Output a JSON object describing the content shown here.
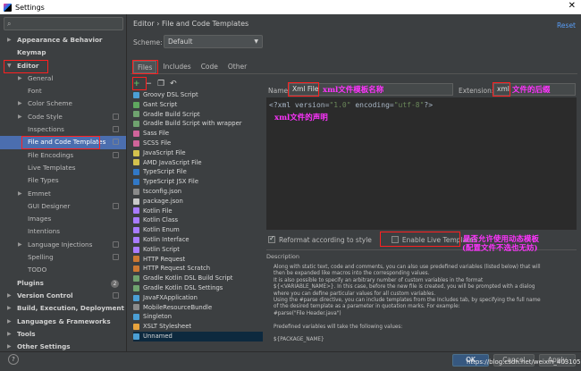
{
  "window": {
    "title": "Settings",
    "close": "✕"
  },
  "search": {
    "placeholder": "",
    "icon": "search-icon"
  },
  "sidebar": {
    "items": [
      {
        "label": "Appearance & Behavior",
        "level": 0,
        "arrow": "▶",
        "bold": true
      },
      {
        "label": "Keymap",
        "level": 0,
        "arrow": "",
        "bold": true
      },
      {
        "label": "Editor",
        "level": 0,
        "arrow": "▼",
        "bold": true
      },
      {
        "label": "General",
        "level": 1,
        "arrow": "▶"
      },
      {
        "label": "Font",
        "level": 1,
        "arrow": ""
      },
      {
        "label": "Color Scheme",
        "level": 1,
        "arrow": "▶"
      },
      {
        "label": "Code Style",
        "level": 1,
        "arrow": "▶",
        "gear": true
      },
      {
        "label": "Inspections",
        "level": 1,
        "arrow": "",
        "gear": true
      },
      {
        "label": "File and Code Templates",
        "level": 1,
        "arrow": "",
        "gear": true,
        "selected": true
      },
      {
        "label": "File Encodings",
        "level": 1,
        "arrow": "",
        "gear": true
      },
      {
        "label": "Live Templates",
        "level": 1,
        "arrow": ""
      },
      {
        "label": "File Types",
        "level": 1,
        "arrow": ""
      },
      {
        "label": "Emmet",
        "level": 1,
        "arrow": "▶"
      },
      {
        "label": "GUI Designer",
        "level": 1,
        "arrow": "",
        "gear": true
      },
      {
        "label": "Images",
        "level": 1,
        "arrow": ""
      },
      {
        "label": "Intentions",
        "level": 1,
        "arrow": ""
      },
      {
        "label": "Language Injections",
        "level": 1,
        "arrow": "▶",
        "gear": true
      },
      {
        "label": "Spelling",
        "level": 1,
        "arrow": "",
        "gear": true
      },
      {
        "label": "TODO",
        "level": 1,
        "arrow": ""
      },
      {
        "label": "Plugins",
        "level": 0,
        "arrow": "",
        "bold": true,
        "badge": "2"
      },
      {
        "label": "Version Control",
        "level": 0,
        "arrow": "▶",
        "bold": true,
        "gear": true
      },
      {
        "label": "Build, Execution, Deployment",
        "level": 0,
        "arrow": "▶",
        "bold": true
      },
      {
        "label": "Languages & Frameworks",
        "level": 0,
        "arrow": "▶",
        "bold": true
      },
      {
        "label": "Tools",
        "level": 0,
        "arrow": "▶",
        "bold": true
      },
      {
        "label": "Other Settings",
        "level": 0,
        "arrow": "▶",
        "bold": true
      }
    ]
  },
  "breadcrumb": {
    "part1": "Editor",
    "sep": "›",
    "part2": "File and Code Templates"
  },
  "reset_label": "Reset",
  "scheme": {
    "label": "Scheme:",
    "value": "Default"
  },
  "tabs": [
    {
      "label": "Files",
      "selected": true
    },
    {
      "label": "Includes"
    },
    {
      "label": "Code"
    },
    {
      "label": "Other"
    }
  ],
  "list_toolbar": {
    "add": "+",
    "remove": "−",
    "copy": "❐",
    "reset": "↶"
  },
  "templates": [
    {
      "label": "Groovy DSL Script",
      "color": "#4b9fd5"
    },
    {
      "label": "Gant Script",
      "color": "#5fa85f"
    },
    {
      "label": "Gradle Build Script",
      "color": "#6fa36f"
    },
    {
      "label": "Gradle Build Script with wrapper",
      "color": "#6fa36f"
    },
    {
      "label": "Sass File",
      "color": "#cf649a"
    },
    {
      "label": "SCSS File",
      "color": "#cf649a"
    },
    {
      "label": "JavaScript File",
      "color": "#d4c14d"
    },
    {
      "label": "AMD JavaScript File",
      "color": "#d4c14d"
    },
    {
      "label": "TypeScript File",
      "color": "#3178c6"
    },
    {
      "label": "TypeScript JSX File",
      "color": "#3178c6"
    },
    {
      "label": "tsconfig.json",
      "color": "#8a8a8a"
    },
    {
      "label": "package.json",
      "color": "#c9c9c9"
    },
    {
      "label": "Kotlin File",
      "color": "#a97bff"
    },
    {
      "label": "Kotlin Class",
      "color": "#a97bff"
    },
    {
      "label": "Kotlin Enum",
      "color": "#a97bff"
    },
    {
      "label": "Kotlin Interface",
      "color": "#a97bff"
    },
    {
      "label": "Kotlin Script",
      "color": "#a97bff"
    },
    {
      "label": "HTTP Request",
      "color": "#cc7832"
    },
    {
      "label": "HTTP Request Scratch",
      "color": "#cc7832"
    },
    {
      "label": "Gradle Kotlin DSL Build Script",
      "color": "#6fa36f"
    },
    {
      "label": "Gradle Kotlin DSL Settings",
      "color": "#6fa36f"
    },
    {
      "label": "JavaFXApplication",
      "color": "#4b9fd5"
    },
    {
      "label": "MobileResourceBundle",
      "color": "#8a8a8a"
    },
    {
      "label": "Singleton",
      "color": "#4b9fd5"
    },
    {
      "label": "XSLT Stylesheet",
      "color": "#e8a33d"
    },
    {
      "label": "Unnamed",
      "color": "#4b9fd5",
      "selected": true
    }
  ],
  "name_field": {
    "label": "Name:",
    "value": "Xml File"
  },
  "extension_field": {
    "label": "Extension:",
    "value": "xml"
  },
  "editor": {
    "line1_a": "<?xml version=",
    "line1_s1": "\"1.0\"",
    "line1_b": " encoding=",
    "line1_s2": "\"utf-8\"",
    "line1_c": "?>"
  },
  "options": {
    "reformat": "Reformat according to style",
    "reformat_checked": true,
    "live": "Enable Live Templates",
    "live_checked": false
  },
  "description": {
    "header": "Description",
    "lines": [
      "Along with static text, code and comments, you can also use predefined variables (listed below) that will",
      "then be expanded like macros into the corresponding values.",
      "It is also possible to specify an arbitrary number of custom variables in the format",
      "${<VARIABLE_NAME>}. In this case, before the new file is created, you will be prompted with a dialog",
      "where you can define particular values for all custom variables.",
      "Using the #parse directive, you can include templates from the Includes tab, by specifying the full name",
      "of the desired template as a parameter in quotation marks. For example:",
      "#parse(\"File Header.java\")",
      "",
      "Predefined variables will take the following values:",
      "",
      "${PACKAGE_NAME}"
    ]
  },
  "annotations": {
    "name": "xml文件模板名称",
    "ext": "文件的后缀",
    "decl": "xml文件的声明",
    "live1": "是否允许使用动态模板",
    "live2": "(配置文件不选也无妨)"
  },
  "buttons": {
    "help": "?",
    "ok": "OK",
    "cancel": "Cancel",
    "apply": "Apply"
  },
  "watermark": "https://blog.csdn.net/weixin_40310530"
}
